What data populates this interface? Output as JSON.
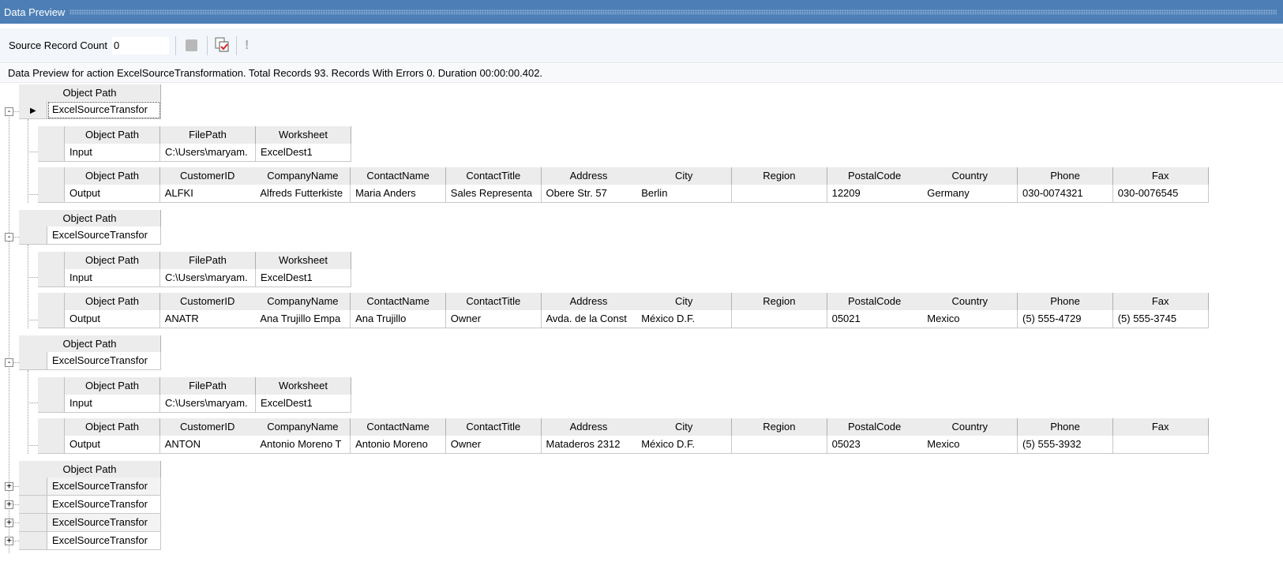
{
  "title": "Data Preview",
  "toolbar": {
    "source_record_count_label": "Source Record Count",
    "source_record_count_value": "0",
    "icons": [
      "stop-icon",
      "preview-checklist-icon",
      "exclamation-icon"
    ]
  },
  "status": "Data Preview for action ExcelSourceTransformation. Total Records 93. Records With Errors 0. Duration 00:00:00.402.",
  "outer_header": "Object Path",
  "input_headers": [
    "Object Path",
    "FilePath",
    "Worksheet"
  ],
  "output_headers": [
    "Object Path",
    "CustomerID",
    "CompanyName",
    "ContactName",
    "ContactTitle",
    "Address",
    "City",
    "Region",
    "PostalCode",
    "Country",
    "Phone",
    "Fax"
  ],
  "expanded_groups": [
    {
      "object_path": "ExcelSourceTransfor",
      "input": [
        "Input",
        "C:\\Users\\maryam.",
        "ExcelDest1"
      ],
      "output": [
        "Output",
        "ALFKI",
        "Alfreds Futterkiste",
        "Maria Anders",
        "Sales Representa",
        "Obere Str. 57",
        "Berlin",
        "",
        "12209",
        "Germany",
        "030-0074321",
        "030-0076545"
      ]
    },
    {
      "object_path": "ExcelSourceTransfor",
      "input": [
        "Input",
        "C:\\Users\\maryam.",
        "ExcelDest1"
      ],
      "output": [
        "Output",
        "ANATR",
        "Ana Trujillo Empa",
        "Ana Trujillo",
        "Owner",
        "Avda. de la Const",
        "México D.F.",
        "",
        "05021",
        "Mexico",
        "(5) 555-4729",
        "(5) 555-3745"
      ]
    },
    {
      "object_path": "ExcelSourceTransfor",
      "input": [
        "Input",
        "C:\\Users\\maryam.",
        "ExcelDest1"
      ],
      "output": [
        "Output",
        "ANTON",
        "Antonio Moreno T",
        "Antonio Moreno",
        "Owner",
        "Mataderos  2312",
        "México D.F.",
        "",
        "05023",
        "Mexico",
        "(5) 555-3932",
        ""
      ]
    }
  ],
  "collapsed_group": {
    "rows": [
      "ExcelSourceTransfor",
      "ExcelSourceTransfor",
      "ExcelSourceTransfor",
      "ExcelSourceTransfor"
    ]
  }
}
